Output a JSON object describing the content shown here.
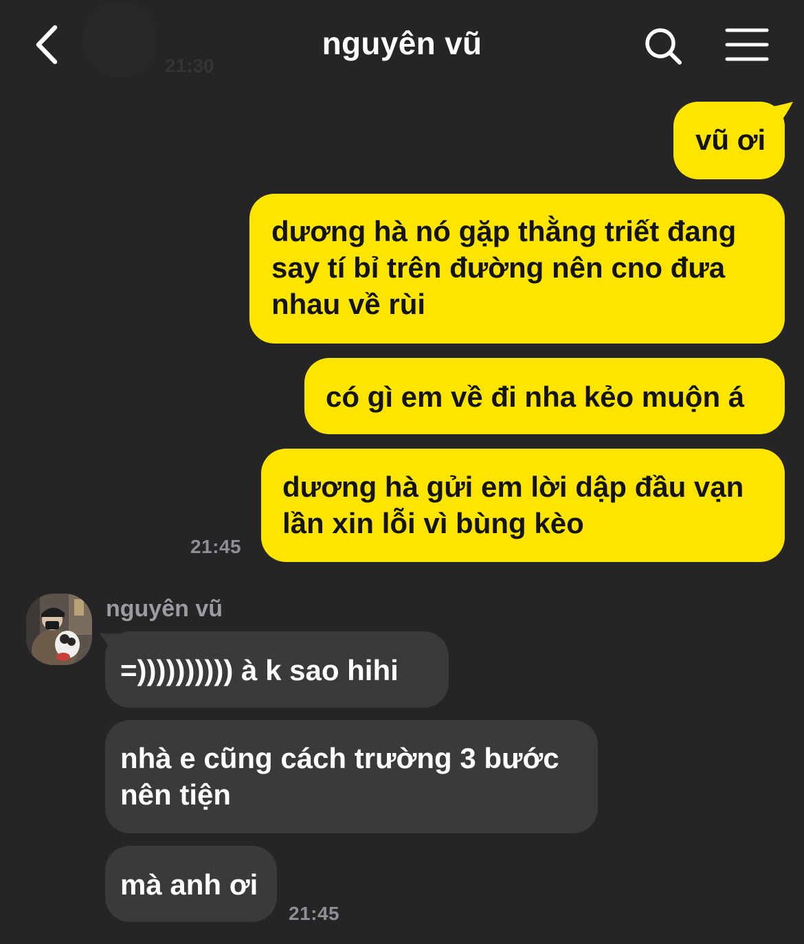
{
  "header": {
    "title": "nguyên vũ",
    "ghost_time": "21:30",
    "back_icon": "chevron-left-icon",
    "search_icon": "search-icon",
    "menu_icon": "hamburger-menu-icon"
  },
  "colors": {
    "background": "#252527",
    "outgoing_bubble": "#fee500",
    "incoming_bubble": "#3a3a3c",
    "timestamp": "#8e8e93"
  },
  "outgoing": {
    "messages": [
      "vũ ơi",
      "dương hà nó gặp thằng triết đang\nsay tí bỉ trên đường nên cno đưa\nnhau về rùi",
      "có gì em về đi nha kẻo muộn á",
      "dương hà gửi em lời dập đầu vạn\nlần xin lỗi vì bùng kèo"
    ],
    "time": "21:45"
  },
  "incoming": {
    "sender": "nguyên vũ",
    "messages": [
      "=)))))))))) à k sao hihi",
      "nhà e cũng cách trường 3 bước\nnên tiện",
      "mà anh ơi"
    ],
    "time": "21:45"
  }
}
